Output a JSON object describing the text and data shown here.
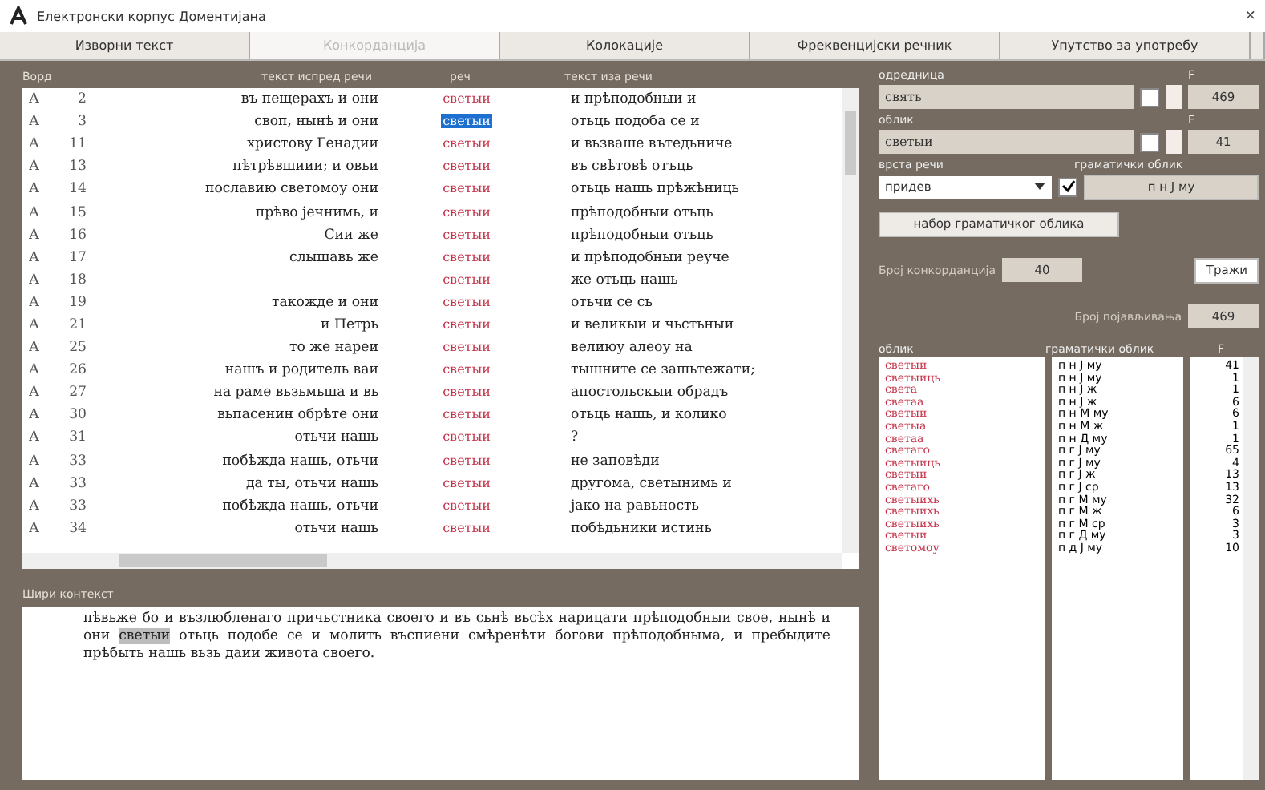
{
  "window": {
    "title": "Електронски корпус Доментијана",
    "close": "×"
  },
  "tabs": [
    {
      "label": "Изворни текст",
      "selected": false,
      "disabled": false
    },
    {
      "label": "Конкорданција",
      "selected": true,
      "disabled": true
    },
    {
      "label": "Колокације",
      "selected": false,
      "disabled": false
    },
    {
      "label": "Фреквенцијски речник",
      "selected": false,
      "disabled": false
    },
    {
      "label": "Упутство за употребу",
      "selected": false,
      "disabled": false
    }
  ],
  "table": {
    "columns": [
      "Ворд",
      "текст испред речи",
      "реч",
      "текст иза речи"
    ],
    "rows": [
      {
        "source": "А",
        "number": "2",
        "before": "въ пещерахъ и они",
        "word": "светыи",
        "after": "и прѣподобныи и",
        "selected": false
      },
      {
        "source": "А",
        "number": "3",
        "before": "своп, нынѣ и они",
        "word": "светыи",
        "after": "отьць подоба се и",
        "selected": true
      },
      {
        "source": "А",
        "number": "11",
        "before": "христову Генадии",
        "word": "светыи",
        "after": "и вьзваше вътедьниче",
        "selected": false
      },
      {
        "source": "А",
        "number": "13",
        "before": "пѣтрѣвшиии; и овьи",
        "word": "светыи",
        "after": "въ свѣтовѣ отъць",
        "selected": false
      },
      {
        "source": "А",
        "number": "14",
        "before": "пославию светомоу они",
        "word": "светыи",
        "after": "отьць нашь прѣжѣниць",
        "selected": false
      },
      {
        "source": "А",
        "number": "15",
        "before": "прѣво јечнимь, и",
        "word": "светыи",
        "after": "прѣподобныи отьць",
        "selected": false
      },
      {
        "source": "А",
        "number": "16",
        "before": "Сии же",
        "word": "светыи",
        "after": "прѣподобныи отьць",
        "selected": false
      },
      {
        "source": "А",
        "number": "17",
        "before": "слышавь же",
        "word": "светыи",
        "after": "и прѣподобныи реуче",
        "selected": false
      },
      {
        "source": "А",
        "number": "18",
        "before": "",
        "word": "светыи",
        "after": "же отьць нашь",
        "selected": false
      },
      {
        "source": "А",
        "number": "19",
        "before": "такожде и они",
        "word": "светыи",
        "after": "отьчи се сь",
        "selected": false
      },
      {
        "source": "А",
        "number": "21",
        "before": "и Петрь",
        "word": "светыи",
        "after": "и великыи и чьстьныи",
        "selected": false
      },
      {
        "source": "А",
        "number": "25",
        "before": "то же нареи",
        "word": "светыи",
        "after": "велиюу алеоу на",
        "selected": false
      },
      {
        "source": "А",
        "number": "26",
        "before": "нашъ и родитель ваи",
        "word": "светыи",
        "after": "тышните се зашьтежати;",
        "selected": false
      },
      {
        "source": "А",
        "number": "27",
        "before": "на раме вьзьмьша и вь",
        "word": "светыи",
        "after": "апостольскыи обрадъ",
        "selected": false
      },
      {
        "source": "А",
        "number": "30",
        "before": "вьпасенин обрѣте они",
        "word": "светыи",
        "after": "отьць нашь, и колико",
        "selected": false
      },
      {
        "source": "А",
        "number": "31",
        "before": "отьчи нашь",
        "word": "светыи",
        "after": "?",
        "selected": false
      },
      {
        "source": "А",
        "number": "33",
        "before": "побѣжда нашь, отьчи",
        "word": "светыи",
        "after": "не заповѣди",
        "selected": false
      },
      {
        "source": "А",
        "number": "33",
        "before": "да ты, отьчи нашь",
        "word": "светыи",
        "after": "другома, светынимь и",
        "selected": false
      },
      {
        "source": "А",
        "number": "33",
        "before": "побѣжда нашь, отьчи",
        "word": "светыи",
        "after": "јако на равьность",
        "selected": false
      },
      {
        "source": "А",
        "number": "34",
        "before": "отьчи нашь",
        "word": "светыи",
        "after": "побѣдьники истинь",
        "selected": false
      }
    ]
  },
  "context": {
    "label": "Шири контекст",
    "before": "пѣвьже бо и възлюбленаго причьстника своего и въ сьнѣ вьсѣх нарицати прѣподобныи свое, нынѣ и они",
    "word": "светыи",
    "after": "отьць подобе се и молить въспиени смѣренѣти богови прѣподобныма, и пребыдите прѣбыть нашь вьзь даии живота своего."
  },
  "search": {
    "lemma_label": "одредница",
    "lemma": "свять",
    "lemma_f_label": "F",
    "lemma_f": "469",
    "lemma_checked": false,
    "form_label": "облик",
    "form": "светыи",
    "form_f_label": "F",
    "form_f": "41",
    "form_checked": false,
    "pos_label": "врста речи",
    "pos": "придев",
    "pos_checked": true,
    "gram_label": "граматички облик",
    "gram": "п н Ј му",
    "gram_set_button": "набор граматичког облика",
    "conc_label": "Број конкорданција",
    "conc": "40",
    "search_button": "Тражи",
    "occ_label": "Број појављивања",
    "occ": "469"
  },
  "forms": {
    "columns": [
      "облик",
      "граматички облик",
      "F"
    ],
    "rows": [
      {
        "form": "светыи",
        "gram": "п н Ј му",
        "f": "41"
      },
      {
        "form": "светыиць",
        "gram": "п н Ј му",
        "f": "1"
      },
      {
        "form": "света",
        "gram": "п н Ј ж",
        "f": "1"
      },
      {
        "form": "светаа",
        "gram": "п н Ј ж",
        "f": "6"
      },
      {
        "form": "светыи",
        "gram": "п н М му",
        "f": "6"
      },
      {
        "form": "светыа",
        "gram": "п н М ж",
        "f": "1"
      },
      {
        "form": "светаа",
        "gram": "п н Д му",
        "f": "1"
      },
      {
        "form": "светаго",
        "gram": "п г Ј му",
        "f": "65"
      },
      {
        "form": "светыиць",
        "gram": "п г Ј му",
        "f": "4"
      },
      {
        "form": "светыи",
        "gram": "п г Ј ж",
        "f": "13"
      },
      {
        "form": "светаго",
        "gram": "п г Ј ср",
        "f": "13"
      },
      {
        "form": "светыихь",
        "gram": "п г М му",
        "f": "32"
      },
      {
        "form": "светыихь",
        "gram": "п г М ж",
        "f": "6"
      },
      {
        "form": "светыихь",
        "gram": "п г М ср",
        "f": "3"
      },
      {
        "form": "светыи",
        "gram": "п г Д му",
        "f": "3"
      },
      {
        "form": "светомоу",
        "gram": "п д Ј му",
        "f": "10"
      }
    ]
  }
}
